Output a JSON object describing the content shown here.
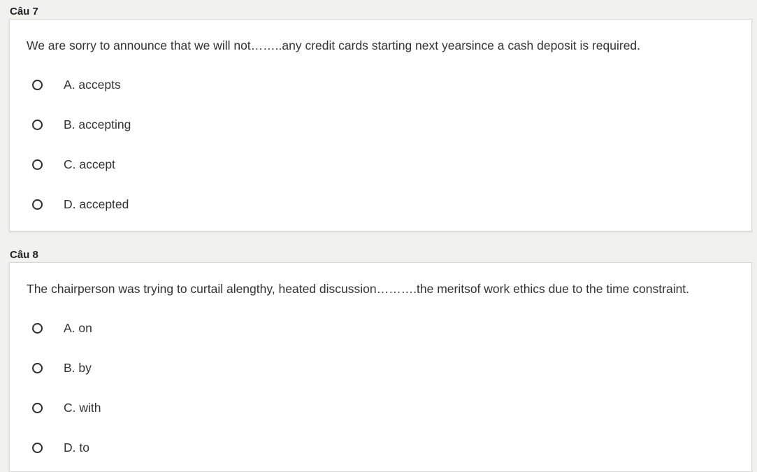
{
  "questions": [
    {
      "header": "Câu 7",
      "text": "We are sorry to announce that we will not……..any credit cards starting next yearsince a cash deposit is required.",
      "options": [
        "A. accepts",
        "B. accepting",
        "C. accept",
        "D. accepted"
      ]
    },
    {
      "header": "Câu 8",
      "text": "The chairperson was trying to curtail alengthy, heated discussion……….the meritsof work ethics due to the time constraint.",
      "options": [
        "A. on",
        "B. by",
        "C. with",
        "D. to"
      ]
    }
  ]
}
